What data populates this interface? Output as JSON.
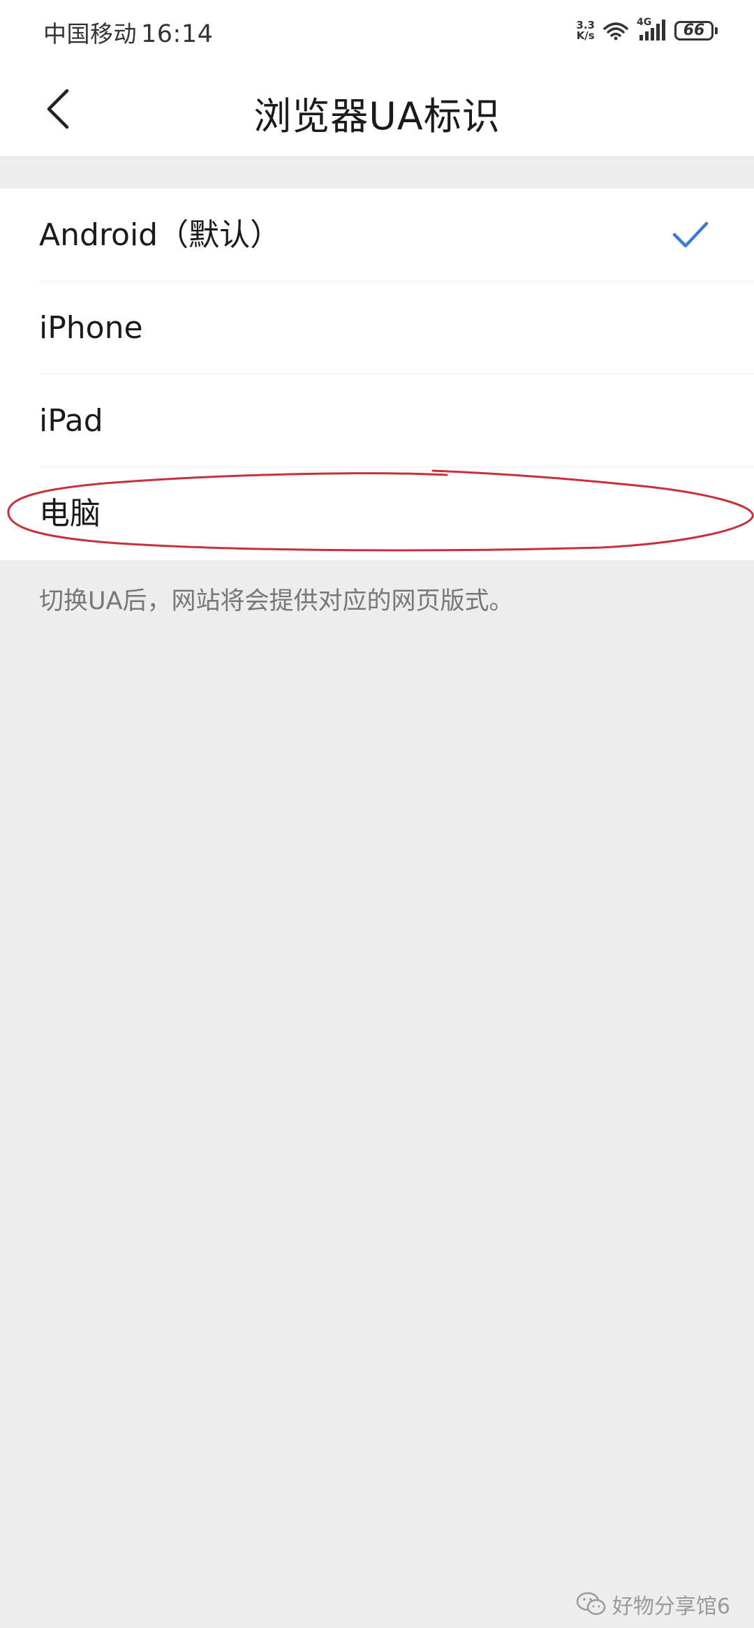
{
  "status_bar": {
    "carrier": "中国移动",
    "time": "16:14",
    "net_speed_value": "3.3",
    "net_speed_unit": "K/s",
    "network_type": "4G",
    "battery": "66"
  },
  "header": {
    "title": "浏览器UA标识"
  },
  "options": [
    {
      "label": "Android（默认）",
      "selected": true
    },
    {
      "label": "iPhone",
      "selected": false
    },
    {
      "label": "iPad",
      "selected": false
    },
    {
      "label": "电脑",
      "selected": false
    }
  ],
  "hint": "切换UA后，网站将会提供对应的网页版式。",
  "watermark": "好物分享馆6",
  "colors": {
    "accent_check": "#3a7bd5",
    "annotation_circle": "#c8303a"
  }
}
